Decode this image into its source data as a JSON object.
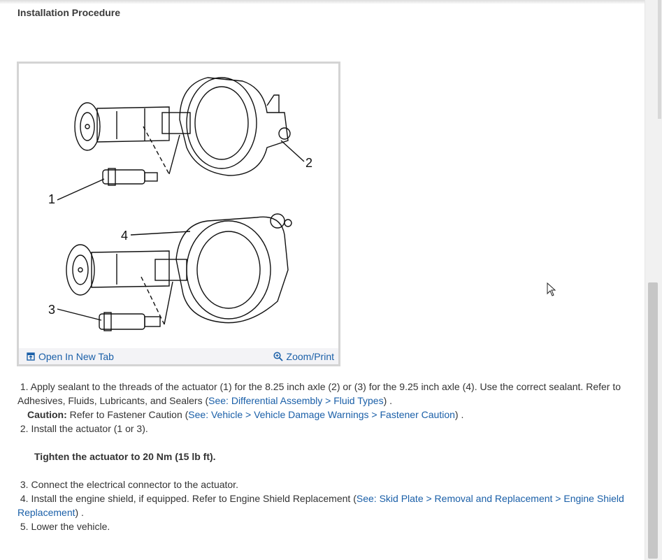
{
  "header": {
    "title": "Installation Procedure"
  },
  "figure": {
    "callouts": [
      "1",
      "2",
      "3",
      "4"
    ],
    "open_tab_label": "Open In New Tab",
    "zoom_label": "Zoom/Print",
    "open_tab_icon": "open-tab-icon",
    "zoom_icon": "magnifier-plus-icon"
  },
  "steps": {
    "s1_prefix": "1. Apply sealant to the threads of the actuator (1) for the 8.25 inch axle (2) or (3) for the 9.25 inch axle (4). Use the correct sealant. Refer to Adhesives, Fluids, Lubricants, and Sealers (",
    "s1_link": "See: Differential Assembly > Fluid Types",
    "s1_suffix": ") .",
    "caution_label": "Caution:",
    "caution_text": " Refer to Fastener Caution (",
    "caution_link": "See: Vehicle > Vehicle Damage Warnings > Fastener Caution",
    "caution_suffix": ") .",
    "s2": "2. Install the actuator (1 or 3).",
    "torque": "Tighten the actuator to 20 Nm (15 lb ft).",
    "s3": "3. Connect the electrical connector to the actuator.",
    "s4_prefix": "4. Install the engine shield, if equipped. Refer to Engine Shield Replacement (",
    "s4_link": "See: Skid Plate > Removal and Replacement > Engine Shield Replacement",
    "s4_suffix": ") .",
    "s5": "5. Lower the vehicle."
  },
  "colors": {
    "link": "#1a5fa8",
    "text": "#333333"
  }
}
